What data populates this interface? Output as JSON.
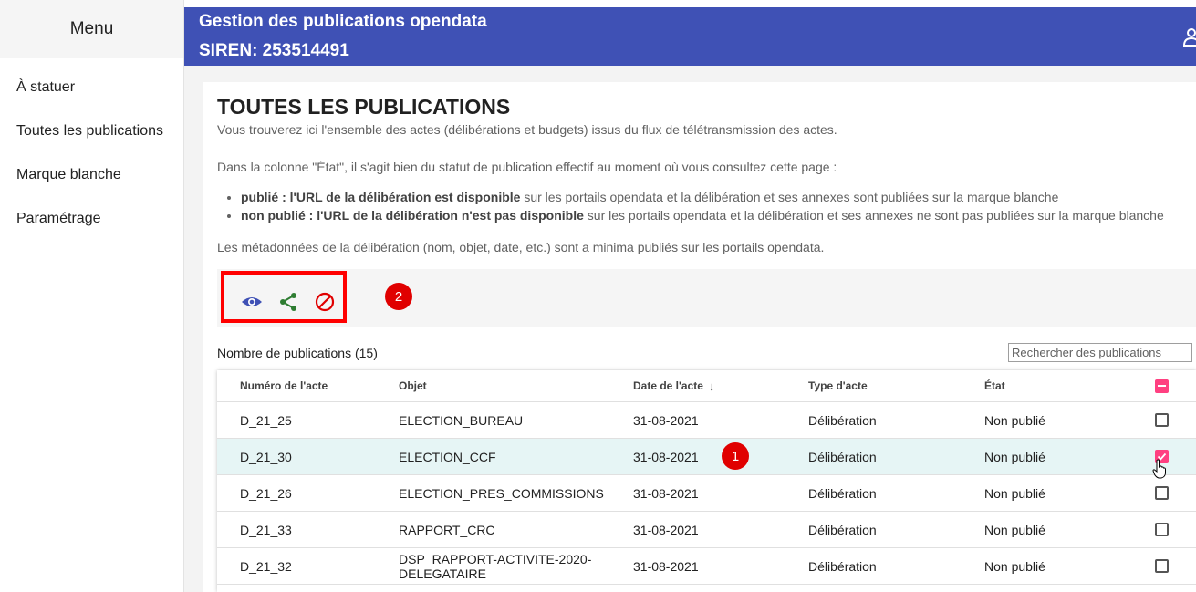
{
  "sidebar": {
    "title": "Menu",
    "items": [
      {
        "label": "À statuer"
      },
      {
        "label": "Toutes les publications"
      },
      {
        "label": "Marque blanche"
      },
      {
        "label": "Paramétrage"
      }
    ]
  },
  "header": {
    "title": "Gestion des publications opendata",
    "siren": "SIREN: 253514491"
  },
  "page": {
    "title": "TOUTES LES PUBLICATIONS",
    "intro": "Vous trouverez ici l'ensemble des actes (délibérations et budgets) issus du flux de télétransmission des actes.",
    "state_note": "Dans la colonne \"État\", il s'agit bien du statut de publication effectif au moment où vous consultez cette page :",
    "bullets": [
      {
        "bold": "publié : l'URL de la délibération est disponible",
        "rest": " sur les portails opendata et la délibération et ses annexes sont publiées sur la marque blanche"
      },
      {
        "bold": "non publié : l'URL de la délibération n'est pas disponible",
        "rest": " sur les portails opendata et la délibération et ses annexes ne sont pas publiées sur la marque blanche"
      }
    ],
    "metadata_note": "Les métadonnées de la délibération (nom, objet, date, etc.) sont a minima publiés sur les portails opendata.",
    "count_label": "Nombre de publications (15)",
    "search_placeholder": "Rechercher des publications"
  },
  "toolbar": {
    "icons": [
      "eye-icon",
      "share-icon",
      "block-icon"
    ],
    "colors": {
      "eye": "#3f51b5",
      "share": "#2e7d32",
      "block": "#e00000"
    }
  },
  "annotations": {
    "badge1": "1",
    "badge2": "2"
  },
  "table": {
    "headers": {
      "numero": "Numéro de l'acte",
      "objet": "Objet",
      "date": "Date de l'acte",
      "type": "Type d'acte",
      "etat": "État"
    },
    "rows": [
      {
        "numero": "D_21_25",
        "objet": "ELECTION_BUREAU",
        "date": "31-08-2021",
        "type": "Délibération",
        "etat": "Non publié",
        "checked": false
      },
      {
        "numero": "D_21_30",
        "objet": "ELECTION_CCF",
        "date": "31-08-2021",
        "type": "Délibération",
        "etat": "Non publié",
        "checked": true
      },
      {
        "numero": "D_21_26",
        "objet": "ELECTION_PRES_COMMISSIONS",
        "date": "31-08-2021",
        "type": "Délibération",
        "etat": "Non publié",
        "checked": false
      },
      {
        "numero": "D_21_33",
        "objet": "RAPPORT_CRC",
        "date": "31-08-2021",
        "type": "Délibération",
        "etat": "Non publié",
        "checked": false
      },
      {
        "numero": "D_21_32",
        "objet": "DSP_RAPPORT-ACTIVITE-2020-DELEGATAIRE",
        "date": "31-08-2021",
        "type": "Délibération",
        "etat": "Non publié",
        "checked": false
      }
    ]
  },
  "colors": {
    "header_bg": "#3f51b5",
    "accent_pink": "#ff4081",
    "selected_row": "#e6f5f5",
    "highlight_red": "#ff0000"
  }
}
